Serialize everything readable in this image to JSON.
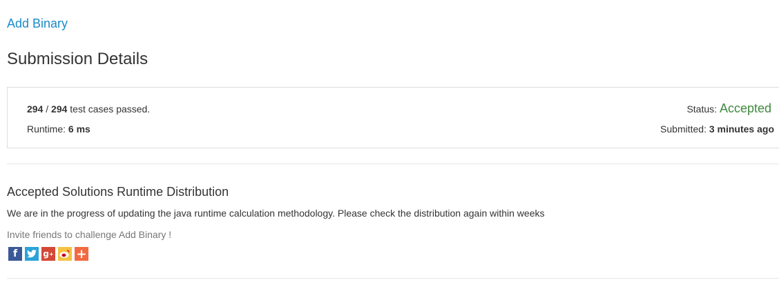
{
  "problem": {
    "link_label": "Add Binary"
  },
  "header": {
    "title": "Submission Details"
  },
  "details": {
    "passed": "294",
    "separator": "/",
    "total": "294",
    "passed_suffix": "test cases passed.",
    "runtime_label": "Runtime:",
    "runtime_value": "6 ms",
    "status_label": "Status:",
    "status_value": "Accepted",
    "submitted_label": "Submitted:",
    "submitted_value": "3 minutes ago"
  },
  "distribution": {
    "title": "Accepted Solutions Runtime Distribution",
    "note": "We are in the progress of updating the java runtime calculation methodology. Please check the distribution again within weeks"
  },
  "invite": {
    "text": "Invite friends to challenge Add Binary !"
  },
  "social": {
    "icons": [
      "facebook-icon",
      "twitter-icon",
      "google-plus-icon",
      "weibo-icon",
      "more-share-icon"
    ],
    "colors": {
      "facebook": "#3b5998",
      "twitter": "#2aa3d8",
      "google_plus": "#d34836",
      "weibo": "#f5c242",
      "more": "#f26a42"
    }
  },
  "colors": {
    "link": "#1a8bc7",
    "accepted": "#3c8a3c"
  }
}
